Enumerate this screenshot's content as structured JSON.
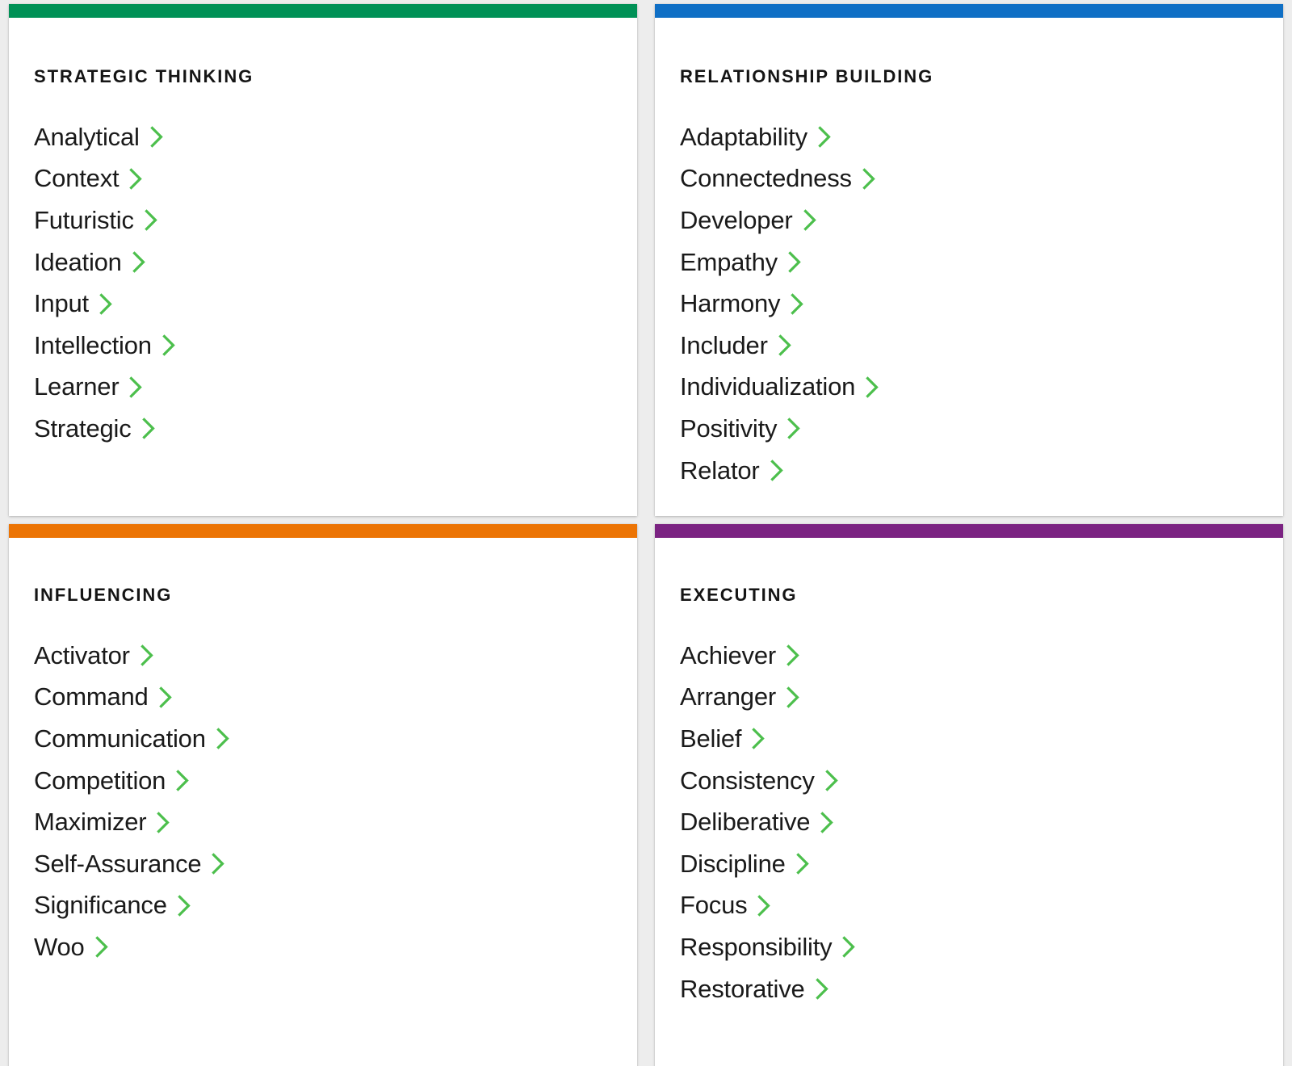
{
  "page": {
    "background_color": "#ededed",
    "card_background": "#ffffff",
    "chevron_color": "#4cbf4c",
    "chevron_icon": "chevron-right-icon"
  },
  "domains": [
    {
      "id": "strategic-thinking",
      "title": "STRATEGIC THINKING",
      "accent_color": "#009156",
      "strengths": [
        "Analytical",
        "Context",
        "Futuristic",
        "Ideation",
        "Input",
        "Intellection",
        "Learner",
        "Strategic"
      ]
    },
    {
      "id": "relationship-building",
      "title": "RELATIONSHIP BUILDING",
      "accent_color": "#0f6fc5",
      "strengths": [
        "Adaptability",
        "Connectedness",
        "Developer",
        "Empathy",
        "Harmony",
        "Includer",
        "Individualization",
        "Positivity",
        "Relator"
      ]
    },
    {
      "id": "influencing",
      "title": "INFLUENCING",
      "accent_color": "#ec7404",
      "strengths": [
        "Activator",
        "Command",
        "Communication",
        "Competition",
        "Maximizer",
        "Self-Assurance",
        "Significance",
        "Woo"
      ]
    },
    {
      "id": "executing",
      "title": "EXECUTING",
      "accent_color": "#7b2382",
      "strengths": [
        "Achiever",
        "Arranger",
        "Belief",
        "Consistency",
        "Deliberative",
        "Discipline",
        "Focus",
        "Responsibility",
        "Restorative"
      ]
    }
  ]
}
